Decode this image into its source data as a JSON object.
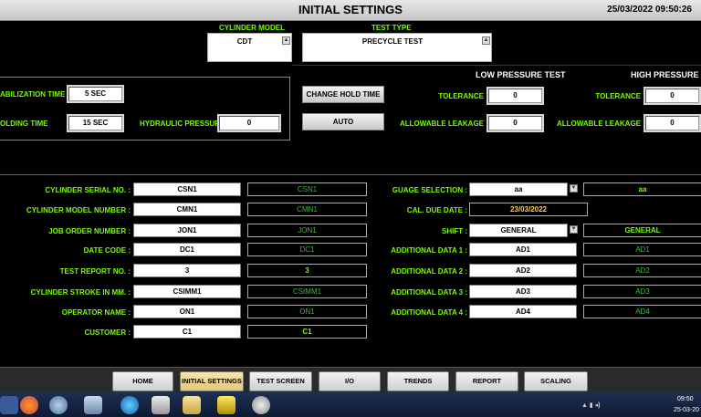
{
  "header": {
    "title": "INITIAL SETTINGS",
    "datetime": "25/03/2022 09:50:26"
  },
  "top": {
    "cylinder_model_label": "CYLINDER MODEL",
    "cylinder_model_value": "CDT",
    "test_type_label": "TEST TYPE",
    "test_type_value": "PRECYCLE TEST"
  },
  "hold": {
    "stabilization_label": "ABILIZATION TIME",
    "stabilization_value": "5 SEC",
    "holding_label": "OLDING TIME",
    "holding_value": "15 SEC",
    "hydraulic_label": "HYDRAULIC PRESSURE",
    "hydraulic_value": "0",
    "change_hold_time": "CHANGE HOLD TIME",
    "auto": "AUTO"
  },
  "low_pressure": {
    "title": "LOW PRESSURE TEST",
    "tolerance_label": "TOLERANCE",
    "tolerance_value": "0",
    "leakage_label": "ALLOWABLE LEAKAGE",
    "leakage_value": "0"
  },
  "high_pressure": {
    "title": "HIGH PRESSURE T",
    "tolerance_label": "TOLERANCE",
    "tolerance_value": "0",
    "leakage_label": "ALLOWABLE LEAKAGE",
    "leakage_value": "0"
  },
  "left_fields": [
    {
      "label": "CYLINDER SERIAL NO. :",
      "value": "CSN1",
      "display": "CSN1"
    },
    {
      "label": "CYLINDER MODEL NUMBER :",
      "value": "CMN1",
      "display": "CMN1"
    },
    {
      "label": "JOB ORDER NUMBER :",
      "value": "JON1",
      "display": "JON1"
    },
    {
      "label": "DATE CODE :",
      "value": "DC1",
      "display": "DC1"
    },
    {
      "label": "TEST REPORT NO. :",
      "value": "3",
      "display": "3"
    },
    {
      "label": "CYLINDER STROKE IN MM. :",
      "value": "CSIMM1",
      "display": "CSIMM1"
    },
    {
      "label": "OPERATOR NAME :",
      "value": "ON1",
      "display": "ON1"
    },
    {
      "label": "CUSTOMER :",
      "value": "C1",
      "display": "C1"
    }
  ],
  "right_fields": {
    "gauge_label": "GUAGE SELECTION :",
    "gauge_value": "aa",
    "gauge_display": "aa",
    "cal_label": "CAL. DUE DATE :",
    "cal_value": "23/03/2022",
    "shift_label": "SHIFT :",
    "shift_value": "GENERAL",
    "shift_display": "GENERAL",
    "additional": [
      {
        "label": "ADDITIONAL DATA 1 :",
        "value": "AD1",
        "display": "AD1"
      },
      {
        "label": "ADDITIONAL DATA 2 :",
        "value": "AD2",
        "display": "AD2"
      },
      {
        "label": "ADDITIONAL DATA 3 :",
        "value": "AD3",
        "display": "AD3"
      },
      {
        "label": "ADDITIONAL DATA 4 :",
        "value": "AD4",
        "display": "AD4"
      }
    ]
  },
  "nav": [
    "HOME",
    "INITIAL SETTINGS",
    "TEST SCREEN",
    "I/O",
    "TRENDS",
    "REPORT",
    "SCALING"
  ],
  "taskbar": {
    "time": "09:50",
    "date": "25-03-20"
  }
}
